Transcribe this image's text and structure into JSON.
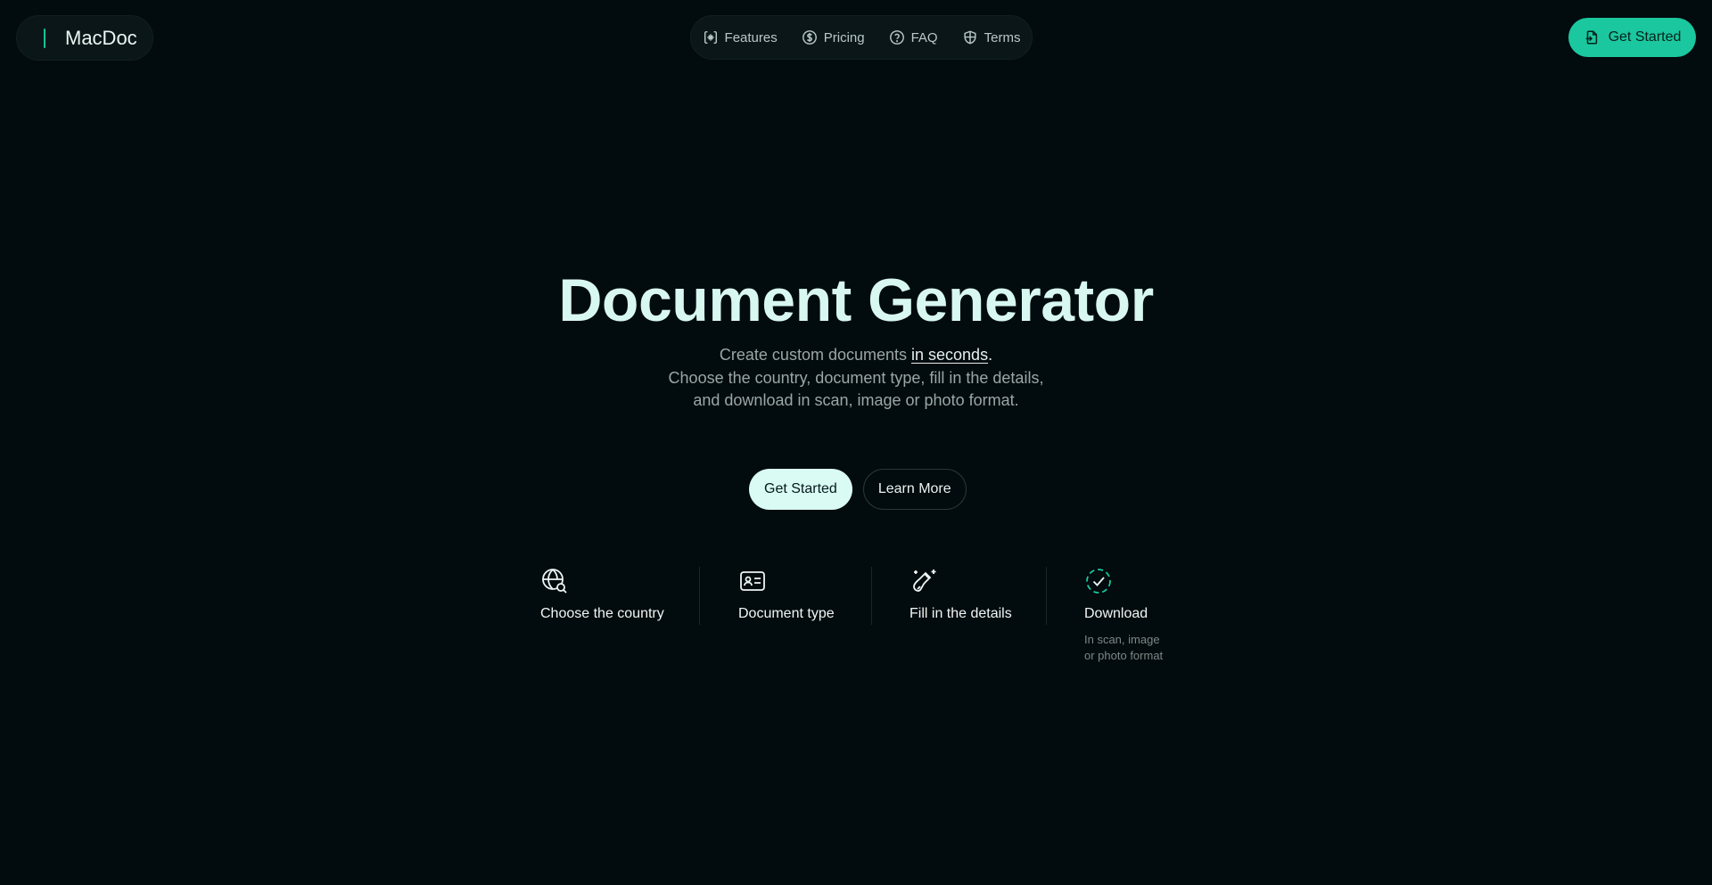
{
  "brand": {
    "name": "MacDoc"
  },
  "nav": {
    "items": [
      {
        "label": "Features",
        "icon": "sparkle-bracket-icon"
      },
      {
        "label": "Pricing",
        "icon": "dollar-circle-icon"
      },
      {
        "label": "FAQ",
        "icon": "question-circle-icon"
      },
      {
        "label": "Terms",
        "icon": "shield-icon"
      }
    ]
  },
  "header": {
    "cta_label": "Get Started"
  },
  "hero": {
    "title": "Document Generator",
    "line1_pre": "Create custom documents ",
    "line1_link": "in seconds",
    "line1_post": ".",
    "line2": "Choose the country, document type, fill in the details,",
    "line3": "and download in scan, image or photo format.",
    "primary_label": "Get Started",
    "secondary_label": "Learn More"
  },
  "steps": [
    {
      "label": "Choose the country",
      "icon": "globe-search-icon"
    },
    {
      "label": "Document type",
      "icon": "id-card-icon"
    },
    {
      "label": "Fill in the details",
      "icon": "pen-sparkle-icon"
    },
    {
      "label": "Download",
      "icon": "check-circle-dashed-icon",
      "note_line1": "In scan, image",
      "note_line2": "or photo format"
    }
  ],
  "colors": {
    "background": "#020b0e",
    "accent": "#1bc79f",
    "title": "#d8f7f1"
  }
}
